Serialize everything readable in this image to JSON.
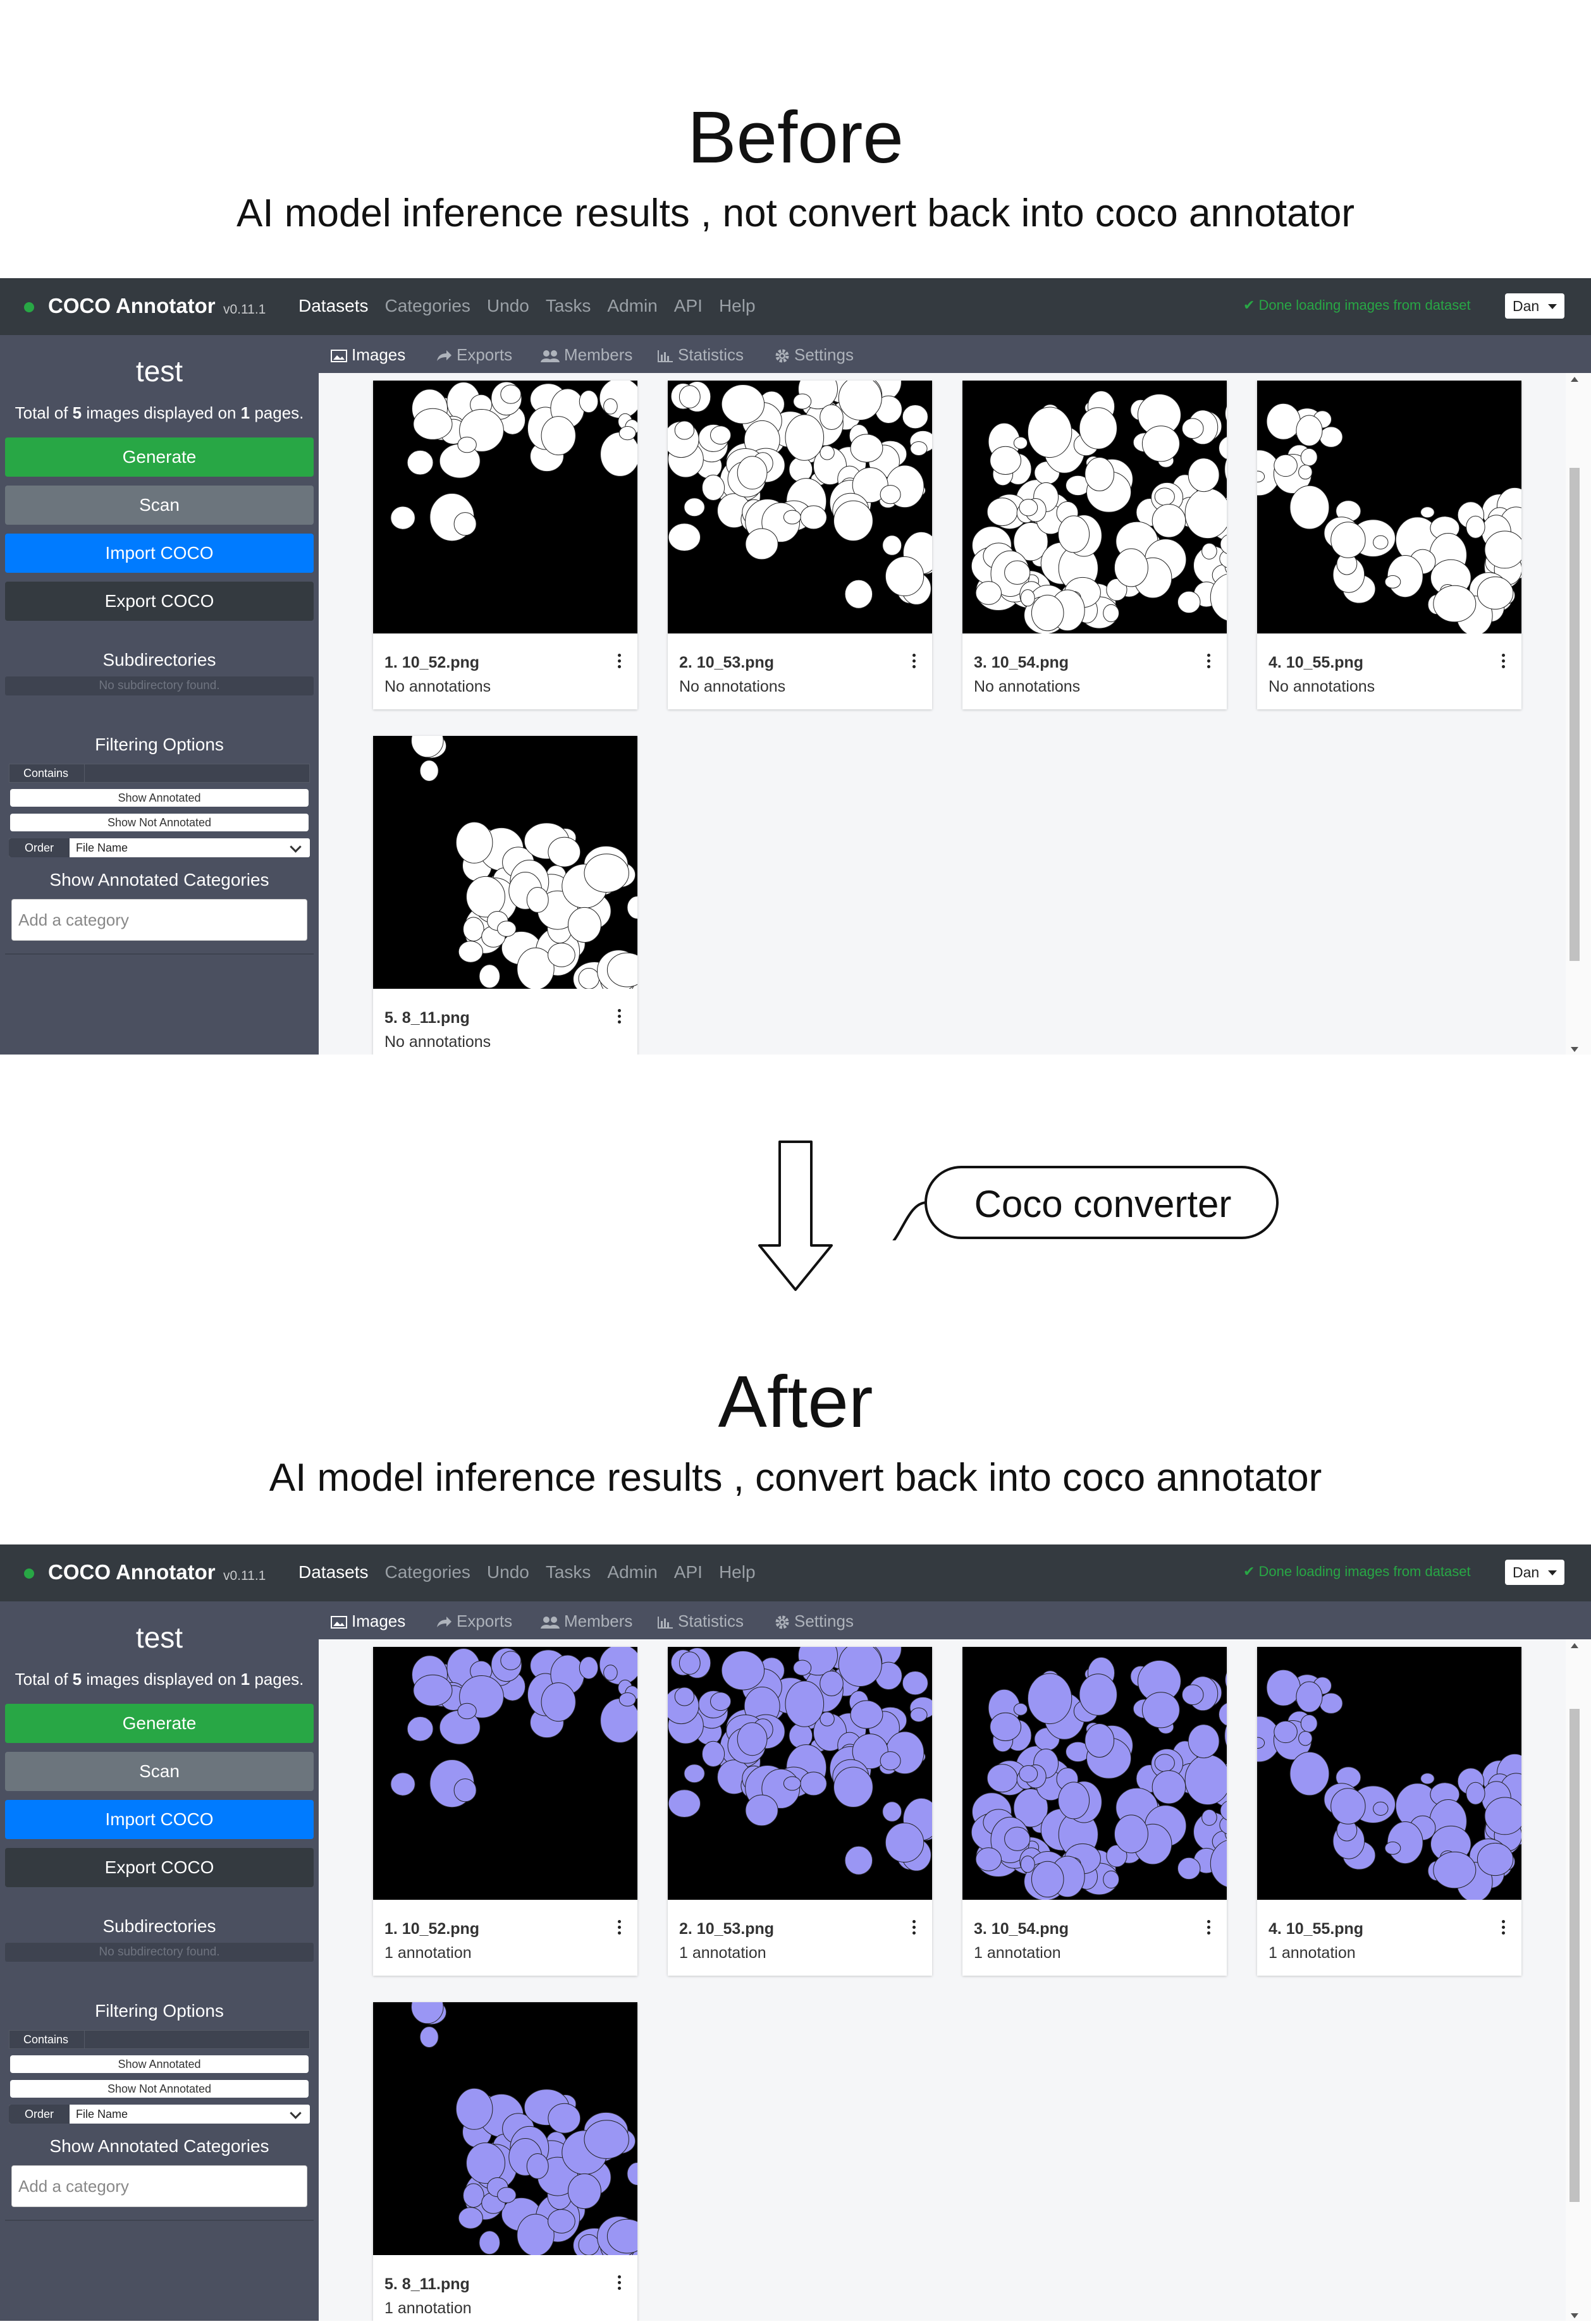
{
  "before": {
    "title": "Before",
    "subtitle": "AI model inference results , not convert back into coco annotator"
  },
  "after": {
    "title": "After",
    "subtitle": "AI model inference results , convert back into coco annotator"
  },
  "converter_label": "Coco converter",
  "app": {
    "brand": "COCO Annotator",
    "version": "v0.11.1",
    "nav": [
      "Datasets",
      "Categories",
      "Undo",
      "Tasks",
      "Admin",
      "API",
      "Help"
    ],
    "status": "✔ Done loading images from dataset",
    "user": "Dan",
    "tabs": [
      "Images",
      "Exports",
      "Members",
      "Statistics",
      "Settings"
    ],
    "dataset_name": "test",
    "total_text": {
      "pre": "Total of ",
      "count": "5",
      "mid": " images displayed on ",
      "pages": "1",
      "post": " pages."
    },
    "buttons": {
      "generate": "Generate",
      "scan": "Scan",
      "import": "Import COCO",
      "export": "Export COCO"
    },
    "subdirectories_title": "Subdirectories",
    "subdirectories_empty": "No subdirectory found.",
    "filtering_title": "Filtering Options",
    "contains_label": "Contains",
    "show_annotated": "Show Annotated",
    "show_not_annotated": "Show Not Annotated",
    "order_label": "Order",
    "order_value": "File Name",
    "show_annotated_categories": "Show Annotated Categories",
    "category_placeholder": "Add a category"
  },
  "before_cards": [
    {
      "title": "1. 10_52.png",
      "sub": "No annotations"
    },
    {
      "title": "2. 10_53.png",
      "sub": "No annotations"
    },
    {
      "title": "3. 10_54.png",
      "sub": "No annotations"
    },
    {
      "title": "4. 10_55.png",
      "sub": "No annotations"
    },
    {
      "title": "5. 8_11.png",
      "sub": "No annotations"
    }
  ],
  "after_cards": [
    {
      "title": "1. 10_52.png",
      "sub": "1 annotation"
    },
    {
      "title": "2. 10_53.png",
      "sub": "1 annotation"
    },
    {
      "title": "3. 10_54.png",
      "sub": "1 annotation"
    },
    {
      "title": "4. 10_55.png",
      "sub": "1 annotation"
    },
    {
      "title": "5. 8_11.png",
      "sub": "1 annotation"
    }
  ],
  "colors": {
    "navbar": "#343a40",
    "sidebar": "#4b5060",
    "generate": "#28a745",
    "scan": "#6c757d",
    "import": "#007bff",
    "export": "#343a40",
    "blob_before": "#ffffff",
    "blob_after": "#9a96f4"
  }
}
